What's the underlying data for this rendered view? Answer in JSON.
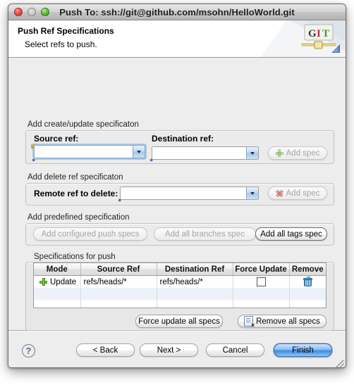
{
  "window": {
    "title": "Push To: ssh://git@github.com/msohn/HelloWorld.git",
    "close_label": "close",
    "minimize_label": "minimize",
    "zoom_label": "zoom"
  },
  "banner": {
    "title": "Push Ref Specifications",
    "subtitle": "Select refs to push.",
    "logo_g": "G",
    "logo_i": "I",
    "logo_t": "T"
  },
  "create_update_group": {
    "label": "Add create/update specificaton",
    "source_ref_label": "Source ref:",
    "source_ref_value": "",
    "destination_ref_label": "Destination ref:",
    "destination_ref_value": "",
    "add_spec_label": "Add spec"
  },
  "delete_group": {
    "label": "Add delete ref specificaton",
    "remote_ref_label": "Remote ref to delete:",
    "remote_ref_value": "",
    "add_spec_label": "Add spec"
  },
  "predefined_group": {
    "label": "Add predefined specification",
    "configured_push_specs_label": "Add configured push specs",
    "all_branches_label": "Add all branches spec",
    "all_tags_label": "Add all tags spec"
  },
  "specs_table": {
    "label": "Specifications for push",
    "columns": [
      "Mode",
      "Source Ref",
      "Destination Ref",
      "Force Update",
      "Remove"
    ],
    "rows": [
      {
        "mode": "Update",
        "mode_icon": "plus-icon",
        "source_ref": "refs/heads/*",
        "destination_ref": "refs/heads/*",
        "force_update": false,
        "remove_icon": "trash-icon"
      }
    ],
    "empty_row_count": 3,
    "force_update_all_label": "Force update all specs",
    "remove_all_label": "Remove all specs"
  },
  "footer": {
    "help_label": "?",
    "back_label": "< Back",
    "next_label": "Next >",
    "cancel_label": "Cancel",
    "finish_label": "Finish"
  }
}
